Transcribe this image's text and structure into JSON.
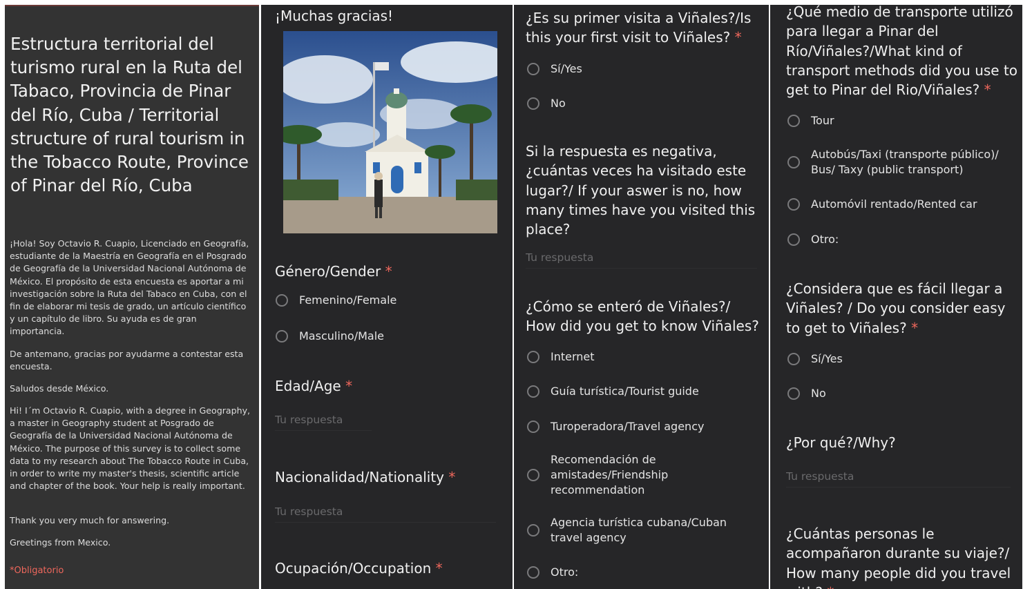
{
  "header": {
    "title": "Estructura territorial del turismo rural en la Ruta del Tabaco, Provincia de Pinar del Río, Cuba / Territorial structure of rural tourism in the Tobacco Route, Province of Pinar del Río, Cuba",
    "paragraphs": [
      "¡Hola! Soy Octavio R. Cuapio, Licenciado en Geografía, estudiante de la Maestría en Geografía en el Posgrado de Geografía de la Universidad Nacional Autónoma de México. El propósito de esta encuesta es aportar a mi investigación sobre la Ruta del Tabaco en Cuba, con el fin de elaborar mi tesis de grado, un artículo científico y un capítulo de libro. Su ayuda es de gran importancia.",
      "De antemano, gracias por ayudarme a contestar esta encuesta.",
      "Saludos desde México.",
      "Hi! I´m Octavio R. Cuapio, with a degree in Geography, a master in Geography student at Posgrado de Geografía de la Universidad Nacional Autónoma de México. The purpose of this survey is to collect some data to my research about The Tobacco Route in Cuba, in order to write my master's thesis, scientific article and chapter of the book. Your help is really important.",
      "Thank you very much for answering.",
      "Greetings from Mexico."
    ],
    "required_note": "*Obligatorio"
  },
  "thanks": "¡Muchas gracias!",
  "required_mark": "*",
  "answer_placeholder": "Tu respuesta",
  "colors": {
    "background": "#262628",
    "header_panel": "#333333",
    "required": "#ee675c",
    "text": "#e8e8e8"
  },
  "questions": {
    "gender": {
      "title": "Género/Gender",
      "options": [
        "Femenino/Female",
        "Masculino/Male"
      ]
    },
    "age": {
      "title": "Edad/Age"
    },
    "nationality": {
      "title": "Nacionalidad/Nationality"
    },
    "occupation": {
      "title": "Ocupación/Occupation"
    },
    "first_visit": {
      "title": "¿Es su primer visita a Viñales?/Is this your first visit to Viñales?",
      "options": [
        "Sí/Yes",
        "No"
      ]
    },
    "times_visited": {
      "title": "Si la respuesta es negativa, ¿cuántas veces ha visitado este lugar?/ If your aswer is no, how many times have you visited this place?"
    },
    "how_know": {
      "title": "¿Cómo se enteró de Viñales?/ How did you get to know Viñales?",
      "options": [
        "Internet",
        "Guía turística/Tourist guide",
        "Turoperadora/Travel agency",
        "Recomendación de amistades/Friendship recommendation",
        "Agencia turística cubana/Cuban travel agency",
        "Otro:"
      ]
    },
    "transport": {
      "title": "¿Qué medio de transporte utilizó para llegar a Pinar del Río/Viñales?/What kind of transport methods did you use to get to Pinar del Rio/Viñales?",
      "options": [
        "Tour",
        "Autobús/Taxi (transporte público)/ Bus/ Taxy (public transport)",
        "Automóvil rentado/Rented car",
        "Otro:"
      ]
    },
    "easy_access": {
      "title": "¿Considera que es fácil llegar a Viñales? / Do you consider easy to get to Viñales?",
      "options": [
        "Sí/Yes",
        "No"
      ]
    },
    "why": {
      "title": "¿Por qué?/Why?"
    },
    "companions": {
      "title": "¿Cuántas personas le acompañaron durante su viaje?/ How many people did you travel with?"
    }
  }
}
